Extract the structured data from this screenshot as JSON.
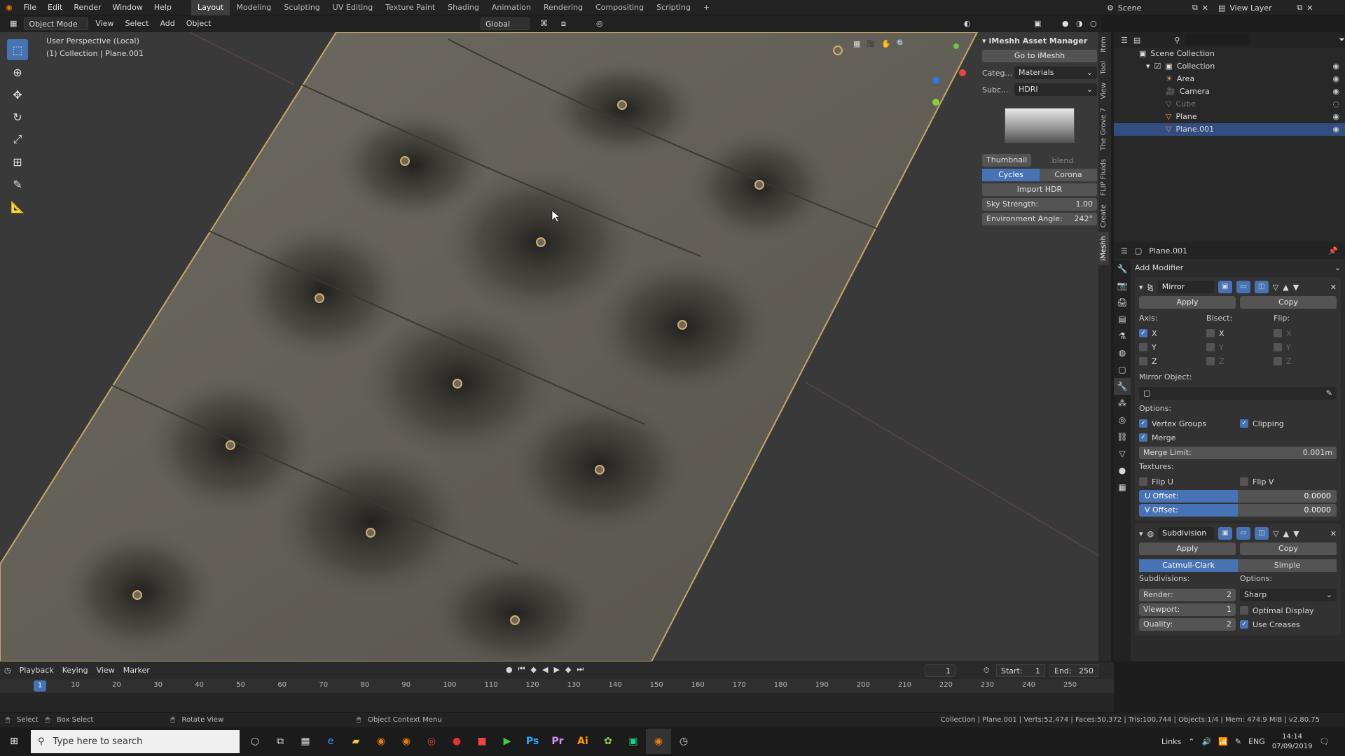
{
  "topbar": {
    "menus": [
      "File",
      "Edit",
      "Render",
      "Window",
      "Help"
    ],
    "workspaces": [
      {
        "label": "Layout",
        "active": true
      },
      {
        "label": "Modeling"
      },
      {
        "label": "Sculpting"
      },
      {
        "label": "UV Editing"
      },
      {
        "label": "Texture Paint"
      },
      {
        "label": "Shading"
      },
      {
        "label": "Animation"
      },
      {
        "label": "Rendering"
      },
      {
        "label": "Compositing"
      },
      {
        "label": "Scripting"
      },
      {
        "label": "+"
      }
    ],
    "scene": "Scene",
    "view_layer": "View Layer"
  },
  "viewport_header": {
    "mode": "Object Mode",
    "menus": [
      "View",
      "Select",
      "Add",
      "Object"
    ],
    "transform_orientation": "Global"
  },
  "viewport": {
    "perspective": "User Perspective (Local)",
    "collection": "(1) Collection | Plane.001"
  },
  "imeshh": {
    "title": "iMeshh Asset Manager",
    "go_button": "Go to iMeshh",
    "category_label": "Categ...",
    "category_value": "Materials",
    "subcategory_label": "Subc...",
    "subcategory_value": "HDRI",
    "thumb_tab": "Thumbnail",
    "blend_tab": ".blend",
    "engine_a": "Cycles",
    "engine_b": "Corona",
    "import_button": "Import HDR",
    "sky_label": "Sky Strength:",
    "sky_value": "1.00",
    "env_label": "Environment Angle:",
    "env_value": "242°"
  },
  "n_tabs": [
    "Item",
    "Tool",
    "View",
    "The Grove 7",
    "FLIP Fluids",
    "Create",
    "iMeshh"
  ],
  "outliner": {
    "root": "Scene Collection",
    "collection": "Collection",
    "items": [
      "Area",
      "Camera",
      "Cube",
      "Plane",
      "Plane.001"
    ]
  },
  "properties": {
    "object_name": "Plane.001",
    "add_modifier": "Add Modifier",
    "mirror": {
      "name": "Mirror",
      "apply": "Apply",
      "copy": "Copy",
      "axis_label": "Axis:",
      "bisect_label": "Bisect:",
      "flip_label": "Flip:",
      "axes": [
        "X",
        "Y",
        "Z"
      ],
      "mirror_object_label": "Mirror Object:",
      "options_label": "Options:",
      "vertex_groups": "Vertex Groups",
      "clipping": "Clipping",
      "merge": "Merge",
      "merge_limit_label": "Merge Limit:",
      "merge_limit_value": "0.001m",
      "textures_label": "Textures:",
      "flip_u": "Flip U",
      "flip_v": "Flip V",
      "u_offset_label": "U Offset:",
      "u_offset_value": "0.0000",
      "v_offset_label": "V Offset:",
      "v_offset_value": "0.0000"
    },
    "subdivision": {
      "name": "Subdivision",
      "apply": "Apply",
      "copy": "Copy",
      "mode_a": "Catmull-Clark",
      "mode_b": "Simple",
      "subdivisions_label": "Subdivisions:",
      "options_label": "Options:",
      "render_label": "Render:",
      "render_value": "2",
      "viewport_label": "Viewport:",
      "viewport_value": "1",
      "quality_label": "Quality:",
      "quality_value": "2",
      "uv_smooth": "Sharp",
      "optimal_display": "Optimal Display",
      "use_creases": "Use Creases"
    }
  },
  "timeline": {
    "menus": [
      "Playback",
      "Keying",
      "View",
      "Marker"
    ],
    "current_frame": "1",
    "start_label": "Start:",
    "start_value": "1",
    "end_label": "End:",
    "end_value": "250",
    "ticks": [
      "1",
      "10",
      "20",
      "30",
      "40",
      "50",
      "60",
      "70",
      "80",
      "90",
      "100",
      "110",
      "120",
      "130",
      "140",
      "150",
      "160",
      "170",
      "180",
      "190",
      "200",
      "210",
      "220",
      "230",
      "240",
      "250"
    ]
  },
  "statusbar": {
    "select": "Select",
    "box_select": "Box Select",
    "rotate_view": "Rotate View",
    "context_menu": "Object Context Menu",
    "stats": "Collection | Plane.001 | Verts:52,474 | Faces:50,372 | Tris:100,744 | Objects:1/4 | Mem: 474.9 MiB | v2.80.75"
  },
  "taskbar": {
    "search_placeholder": "Type here to search",
    "links": "Links",
    "lang": "ENG",
    "time": "14:14",
    "date": "07/09/2019"
  }
}
